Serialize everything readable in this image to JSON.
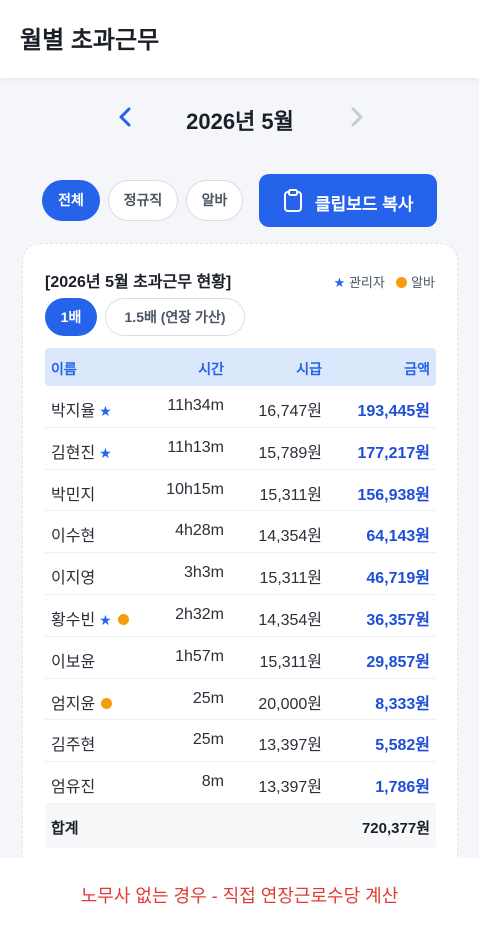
{
  "header": {
    "title": "월별 초과근무"
  },
  "month_nav": {
    "label": "2026년 5월"
  },
  "filters": [
    {
      "label": "전체",
      "active": true
    },
    {
      "label": "정규직",
      "active": false
    },
    {
      "label": "알바",
      "active": false
    }
  ],
  "copy_button": {
    "label": "클립보드 복사",
    "icon": "clipboard-icon"
  },
  "card": {
    "title": "[2026년 5월 초과근무 현황]",
    "legend": {
      "star": "★",
      "star_label": "관리자",
      "dot_label": "알바"
    },
    "rate_tabs": [
      {
        "label": "1배",
        "active": true
      },
      {
        "label": "1.5배 (연장 가산)",
        "active": false
      }
    ],
    "columns": {
      "name": "이름",
      "hours": "시간",
      "wage": "시급",
      "amount": "금액"
    },
    "rows": [
      {
        "name": "박지율",
        "star": "★",
        "parttime": false,
        "hours": "11h34m",
        "wage": "16,747원",
        "amount": "193,445원"
      },
      {
        "name": "김현진",
        "star": "★",
        "parttime": false,
        "hours": "11h13m",
        "wage": "15,789원",
        "amount": "177,217원"
      },
      {
        "name": "박민지",
        "star": "",
        "parttime": false,
        "hours": "10h15m",
        "wage": "15,311원",
        "amount": "156,938원"
      },
      {
        "name": "이수현",
        "star": "",
        "parttime": false,
        "hours": "4h28m",
        "wage": "14,354원",
        "amount": "64,143원"
      },
      {
        "name": "이지영",
        "star": "",
        "parttime": false,
        "hours": "3h3m",
        "wage": "15,311원",
        "amount": "46,719원"
      },
      {
        "name": "황수빈",
        "star": "★",
        "parttime": true,
        "hours": "2h32m",
        "wage": "14,354원",
        "amount": "36,357원"
      },
      {
        "name": "이보윤",
        "star": "",
        "parttime": false,
        "hours": "1h57m",
        "wage": "15,311원",
        "amount": "29,857원"
      },
      {
        "name": "엄지윤",
        "star": "",
        "parttime": true,
        "hours": "25m",
        "wage": "20,000원",
        "amount": "8,333원"
      },
      {
        "name": "김주현",
        "star": "",
        "parttime": false,
        "hours": "25m",
        "wage": "13,397원",
        "amount": "5,582원"
      },
      {
        "name": "엄유진",
        "star": "",
        "parttime": false,
        "hours": "8m",
        "wage": "13,397원",
        "amount": "1,786원"
      }
    ],
    "total": {
      "label": "합계",
      "amount": "720,377원"
    }
  },
  "footer": {
    "note": "노무사 없는 경우 - 직접  연장근로수당 계산"
  },
  "colors": {
    "accent": "#2563eb",
    "parttime_dot": "#f59e0b",
    "note": "#e23b34"
  }
}
